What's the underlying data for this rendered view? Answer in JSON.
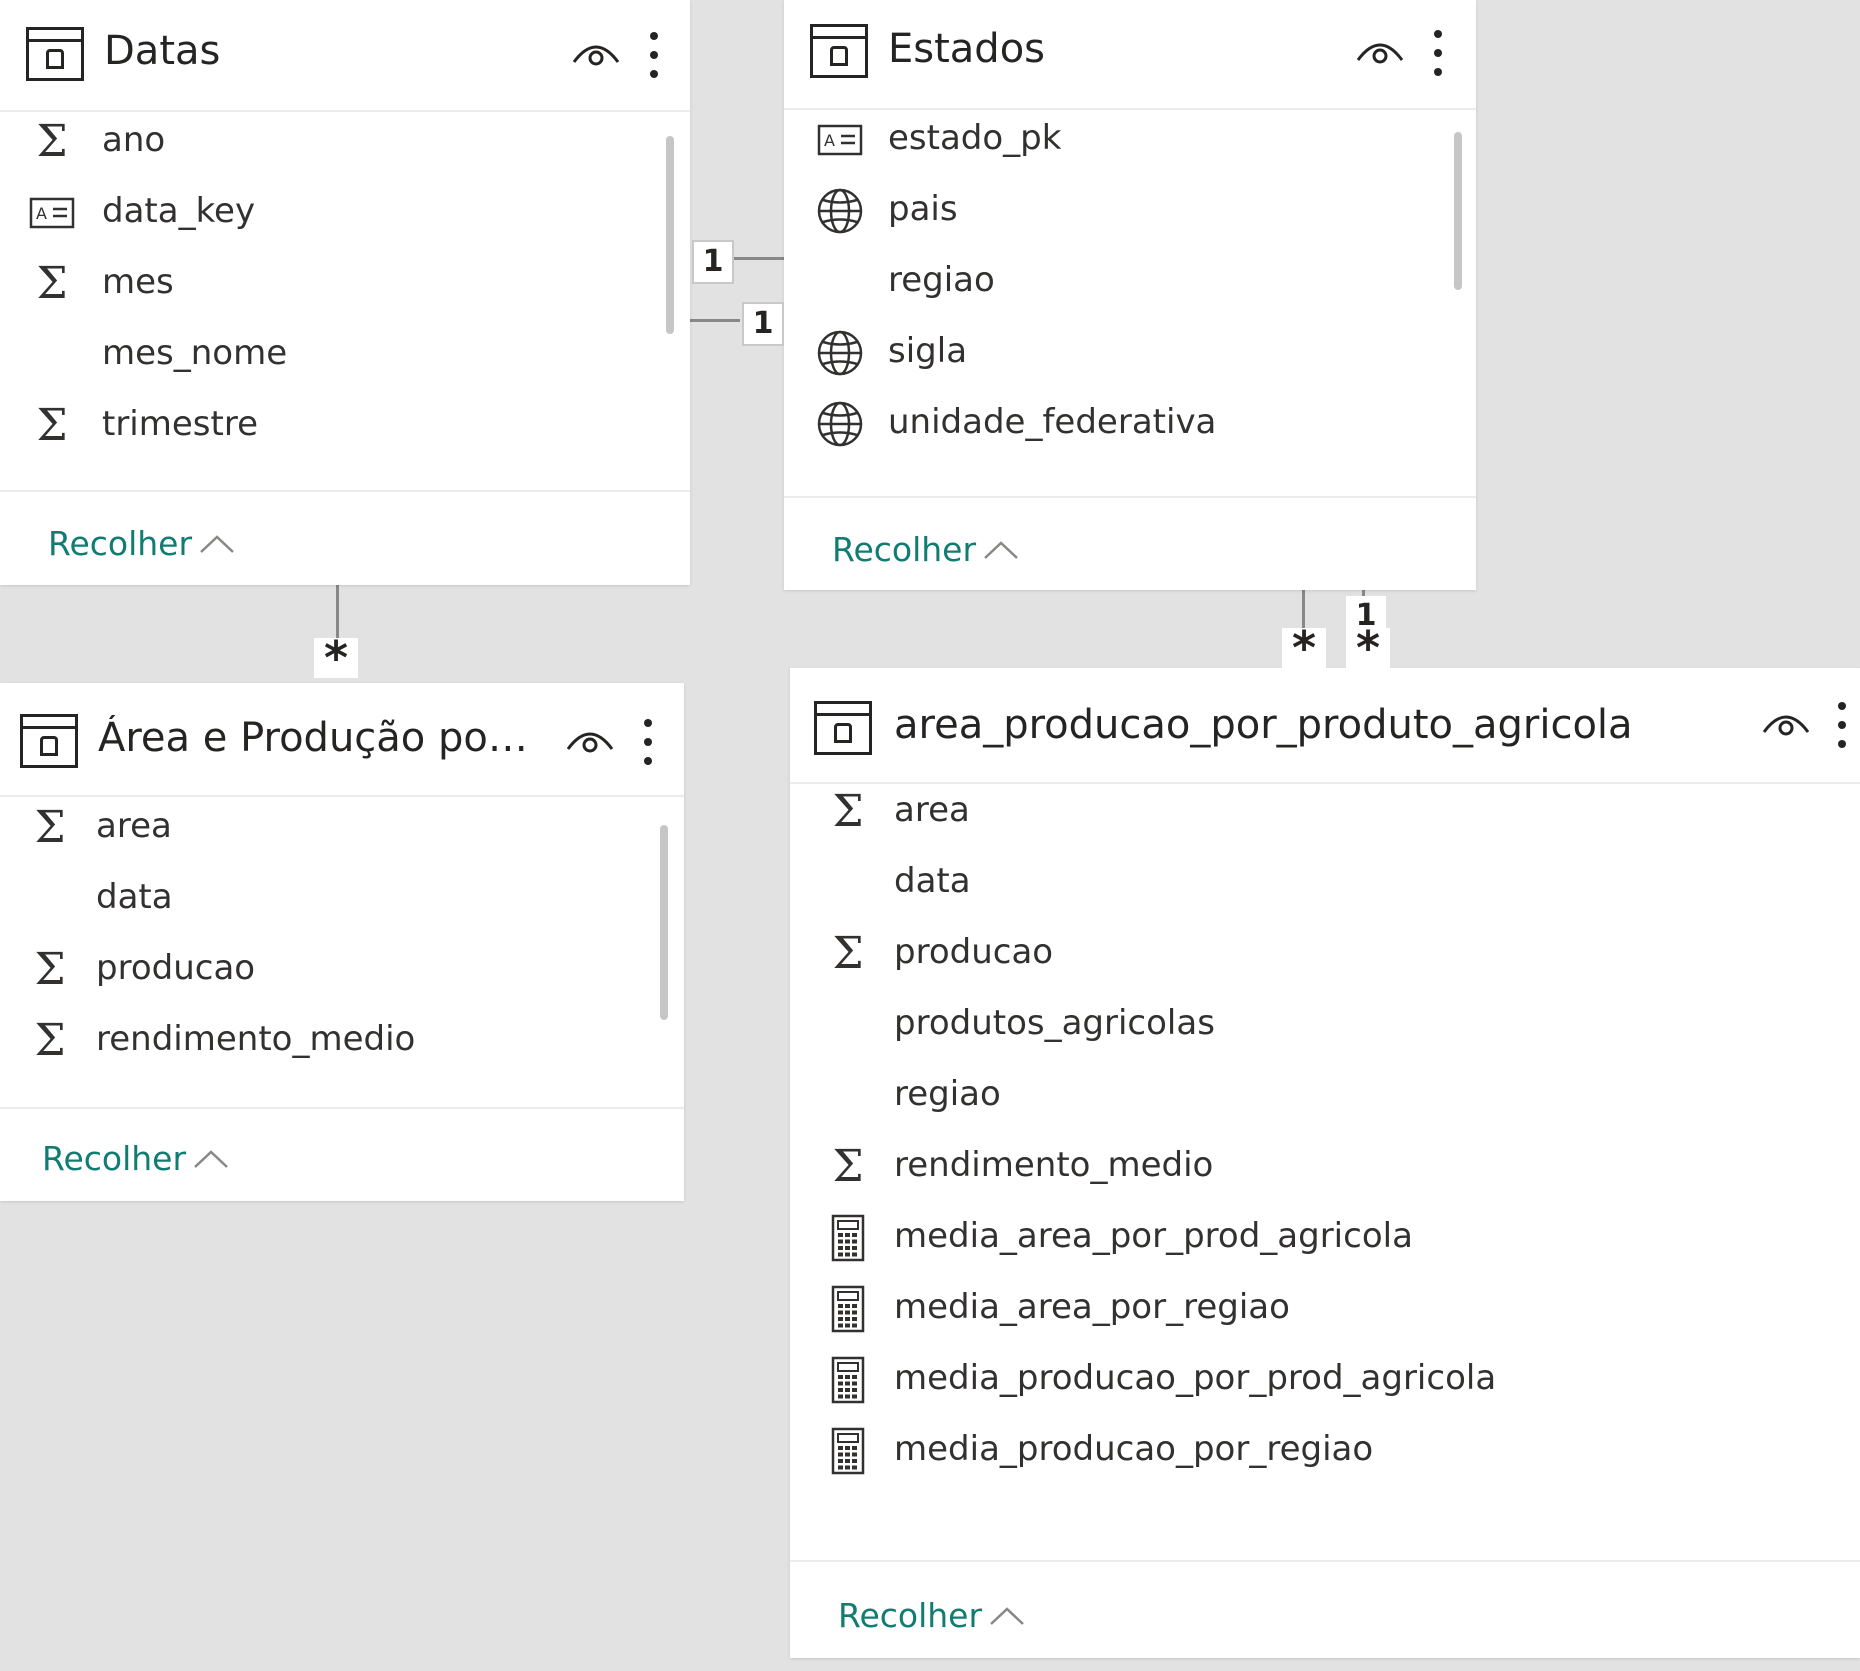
{
  "tables": {
    "datas": {
      "title": "Datas",
      "fields": [
        {
          "name": "ano",
          "icon": "sigma-icon"
        },
        {
          "name": "data_key",
          "icon": "id-card-icon"
        },
        {
          "name": "mes",
          "icon": "sigma-icon"
        },
        {
          "name": "mes_nome",
          "icon": ""
        },
        {
          "name": "trimestre",
          "icon": "sigma-icon"
        }
      ],
      "collapse_label": "Recolher"
    },
    "estados": {
      "title": "Estados",
      "fields": [
        {
          "name": "estado_pk",
          "icon": "id-card-icon"
        },
        {
          "name": "pais",
          "icon": "globe-icon"
        },
        {
          "name": "regiao",
          "icon": ""
        },
        {
          "name": "sigla",
          "icon": "globe-icon"
        },
        {
          "name": "unidade_federativa",
          "icon": "globe-icon"
        }
      ],
      "collapse_label": "Recolher"
    },
    "area_producao": {
      "title": "Área e Produção por ...",
      "fields": [
        {
          "name": "area",
          "icon": "sigma-icon"
        },
        {
          "name": "data",
          "icon": ""
        },
        {
          "name": "producao",
          "icon": "sigma-icon"
        },
        {
          "name": "rendimento_medio",
          "icon": "sigma-icon"
        }
      ],
      "collapse_label": "Recolher"
    },
    "area_producao_agricola": {
      "title": "area_producao_por_produto_agricola",
      "fields": [
        {
          "name": "area",
          "icon": "sigma-icon"
        },
        {
          "name": "data",
          "icon": ""
        },
        {
          "name": "producao",
          "icon": "sigma-icon"
        },
        {
          "name": "produtos_agricolas",
          "icon": ""
        },
        {
          "name": "regiao",
          "icon": ""
        },
        {
          "name": "rendimento_medio",
          "icon": "sigma-icon"
        },
        {
          "name": "media_area_por_prod_agricola",
          "icon": "calculator-icon"
        },
        {
          "name": "media_area_por_regiao",
          "icon": "calculator-icon"
        },
        {
          "name": "media_producao_por_prod_agricola",
          "icon": "calculator-icon"
        },
        {
          "name": "media_producao_por_regiao",
          "icon": "calculator-icon"
        }
      ],
      "collapse_label": "Recolher"
    }
  },
  "relationships": {
    "datas_estados_one_a": "1",
    "datas_estados_one_b": "1",
    "datas_area_many": "*",
    "estados_agricola_many_a": "*",
    "estados_agricola_one": "1",
    "estados_agricola_many_b": "*"
  },
  "colors": {
    "accent": "#107c72",
    "canvas": "#e2e2e2"
  }
}
